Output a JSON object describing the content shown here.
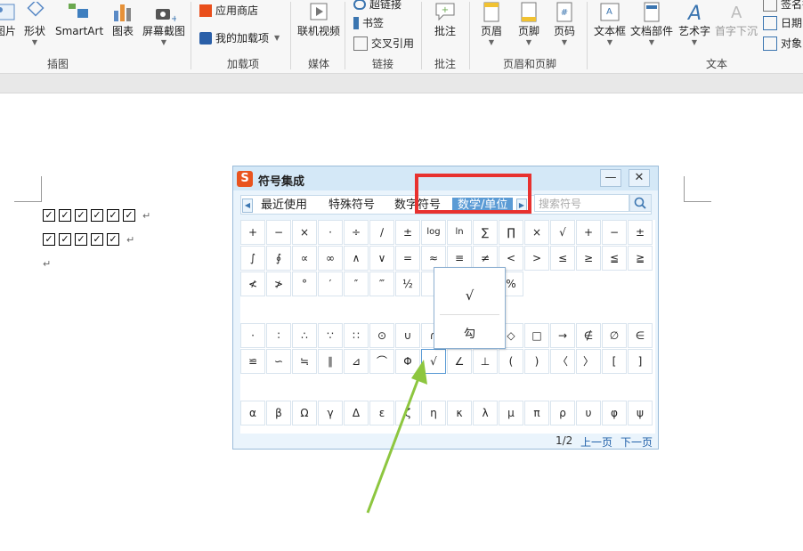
{
  "ribbon": {
    "items": [
      {
        "label": "图片",
        "icon": "picture-icon"
      },
      {
        "label": "形状",
        "icon": "shapes-icon"
      },
      {
        "label": "SmartArt",
        "icon": "smartart-icon"
      },
      {
        "label": "图表",
        "icon": "chart-icon"
      },
      {
        "label": "屏幕截图",
        "icon": "screenshot-icon"
      },
      {
        "label": "联机视频",
        "icon": "video-icon"
      },
      {
        "label": "批注",
        "icon": "comment-icon"
      },
      {
        "label": "页眉",
        "icon": "header-icon"
      },
      {
        "label": "页脚",
        "icon": "footer-icon"
      },
      {
        "label": "页码",
        "icon": "page-number-icon"
      },
      {
        "label": "文本框",
        "icon": "textbox-icon"
      },
      {
        "label": "文档部件",
        "icon": "quickparts-icon"
      },
      {
        "label": "艺术字",
        "icon": "wordart-icon"
      },
      {
        "label": "首字下沉",
        "icon": "dropcap-icon"
      }
    ],
    "small_items": [
      {
        "label": "应用商店",
        "icon": "store-icon"
      },
      {
        "label": "我的加载项",
        "icon": "addins-icon"
      },
      {
        "label": "超链接",
        "icon": "hyperlink-icon"
      },
      {
        "label": "书签",
        "icon": "bookmark-icon"
      },
      {
        "label": "交叉引用",
        "icon": "crossref-icon"
      },
      {
        "label": "签名行",
        "icon": "signature-icon"
      },
      {
        "label": "日期",
        "icon": "date-icon"
      },
      {
        "label": "对象",
        "icon": "object-icon"
      }
    ],
    "groups": [
      "插图",
      "加载项",
      "媒体",
      "链接",
      "批注",
      "页眉和页脚",
      "文本"
    ]
  },
  "document": {
    "line1_checks": 6,
    "line2_checks": 5,
    "check_glyph": "☑",
    "para_mark": "↵"
  },
  "dialog": {
    "title": "符号集成",
    "logo": "S",
    "minimize": "—",
    "close": "✕",
    "tabs": [
      "最近使用",
      "特殊符号",
      "数字符号",
      "数学/单位"
    ],
    "active_tab": "数学/单位",
    "search_placeholder": "搜索符号",
    "grid_rows": [
      [
        "+",
        "−",
        "×",
        "·",
        "÷",
        "∕",
        "±",
        "log",
        "ln",
        "∑",
        "∏",
        "×",
        "√",
        "+",
        "−",
        "±"
      ],
      [
        "∫",
        "∮",
        "∝",
        "∞",
        "∧",
        "∨",
        "=",
        "≈",
        "≡",
        "≠",
        "<",
        ">",
        "≤",
        "≥",
        "≦",
        "≧"
      ],
      [
        "≮",
        "≯",
        "°",
        "′",
        "″",
        "‴",
        "½",
        "",
        "",
        "",
        "%"
      ],
      [],
      [
        "·",
        "∶",
        "∴",
        "∵",
        "∷",
        "⊙",
        "∪",
        "∩",
        "",
        "",
        "◇",
        "□",
        "→",
        "∉",
        "∅",
        "∈"
      ],
      [
        "≌",
        "∽",
        "≒",
        "∥",
        "⊿",
        "⌒",
        "Φ",
        "√",
        "∠",
        "⊥",
        "(",
        ")",
        "〈",
        "〉",
        "[",
        "]"
      ],
      [],
      [
        "α",
        "β",
        "Ω",
        "γ",
        "Δ",
        "ε",
        "ζ",
        "η",
        "κ",
        "λ",
        "μ",
        "π",
        "ρ",
        "υ",
        "φ",
        "ψ"
      ]
    ],
    "footer": {
      "page": "1/2",
      "prev": "上一页",
      "next": "下一页"
    }
  },
  "popup": {
    "items": [
      "√",
      "勾"
    ]
  },
  "colors": {
    "accent": "#5b9bd5",
    "highlight_box": "#e8312f",
    "arrow": "#8dc63f"
  }
}
